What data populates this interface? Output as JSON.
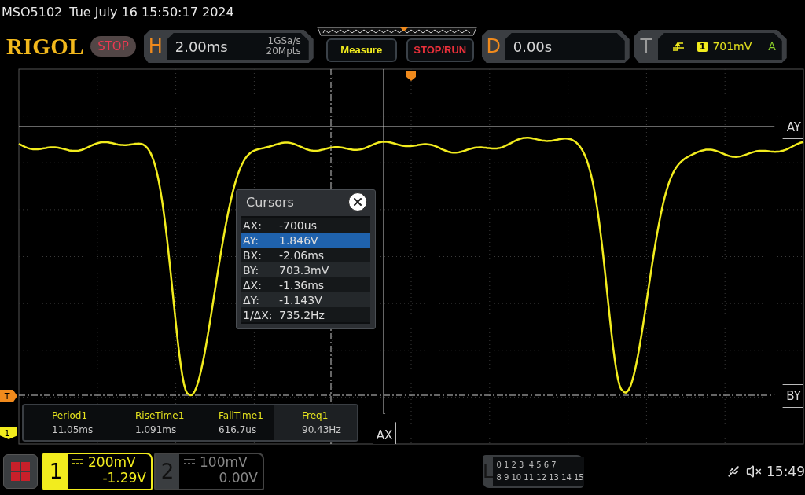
{
  "status_line": {
    "model": "MSO5102",
    "datetime": "Tue July 16 15:50:17 2024"
  },
  "header": {
    "logo": "RIGOL",
    "run_state": "STOP",
    "horizontal": {
      "label": "H",
      "timebase": "2.00ms",
      "sample_rate": "1GSa/s",
      "memory_depth": "20Mpts"
    },
    "buttons": [
      {
        "label": "Measure",
        "kind": "menu"
      },
      {
        "label": "STOP/RUN",
        "kind": "run"
      }
    ],
    "delay": {
      "label": "D",
      "value": "0.00s"
    },
    "trigger": {
      "label": "T",
      "source": "1",
      "level": "701mV",
      "mode": "A"
    }
  },
  "plot": {
    "trigger_marker": "T",
    "channel_marker": "1",
    "cursor_markers": [
      {
        "label": "AY",
        "vertical": false,
        "dashed": false
      },
      {
        "label": "BY",
        "vertical": false,
        "dashed": true
      },
      {
        "label": "AX",
        "vertical": true,
        "dashed": false
      }
    ]
  },
  "cursors_dialog": {
    "title": "Cursors",
    "rows": [
      {
        "label": "AX:",
        "value": "-700us",
        "selected": false
      },
      {
        "label": "AY:",
        "value": "1.846V",
        "selected": true
      },
      {
        "label": "BX:",
        "value": "-2.06ms",
        "selected": false
      },
      {
        "label": "BY:",
        "value": "703.3mV",
        "selected": false
      },
      {
        "label": "ΔX:",
        "value": "-1.36ms",
        "selected": false
      },
      {
        "label": "ΔY:",
        "value": "-1.143V",
        "selected": false
      },
      {
        "label": "1/ΔX:",
        "value": "735.2Hz",
        "selected": false
      }
    ]
  },
  "measurements": [
    {
      "label": "Period1",
      "value": "11.05ms",
      "selected": false
    },
    {
      "label": "RiseTime1",
      "value": "1.091ms",
      "selected": false
    },
    {
      "label": "FallTime1",
      "value": "616.7us",
      "selected": false
    },
    {
      "label": "Freq1",
      "value": "90.43Hz",
      "selected": true
    }
  ],
  "channels": [
    {
      "number": "1",
      "scale": "200mV",
      "offset": "-1.29V",
      "active": true
    },
    {
      "number": "2",
      "scale": "100mV",
      "offset": "0.00V",
      "active": false
    }
  ],
  "logic": {
    "label": "L",
    "bits_row_1": "0 1 2 3  4 5 6 7",
    "bits_row_2": "8 9 10 11 12 13 14 15"
  },
  "clock": "15:49"
}
